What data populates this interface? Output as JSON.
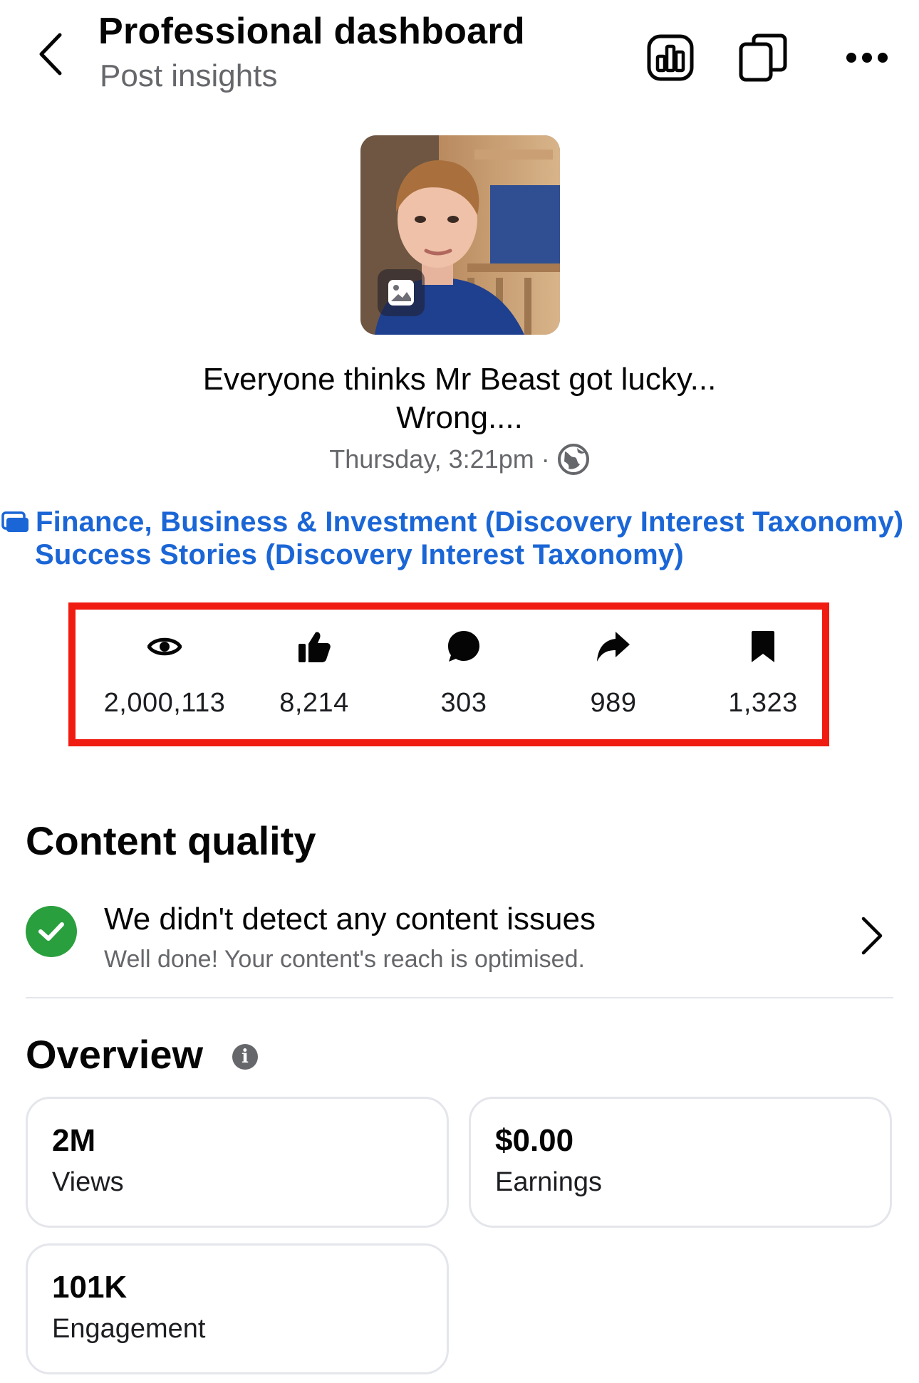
{
  "header": {
    "title": "Professional dashboard",
    "subtitle": "Post insights"
  },
  "post": {
    "caption_line1": "Everyone thinks Mr Beast got lucky...",
    "caption_line2": "Wrong....",
    "timestamp": "Thursday, 3:21pm ·",
    "topics_line1": "Finance, Business & Investment (Discovery Interest Taxonomy)",
    "topics_separator": "•",
    "topics_line2": "Success Stories (Discovery Interest Taxonomy)"
  },
  "stats": [
    {
      "icon": "eye-icon",
      "value": "2,000,113"
    },
    {
      "icon": "like-icon",
      "value": "8,214"
    },
    {
      "icon": "comment-icon",
      "value": "303"
    },
    {
      "icon": "share-icon",
      "value": "989"
    },
    {
      "icon": "bookmark-icon",
      "value": "1,323"
    }
  ],
  "content_quality": {
    "title": "Content quality",
    "status_title": "We didn't detect any content issues",
    "status_subtitle": "Well done! Your content's reach is optimised."
  },
  "overview": {
    "title": "Overview",
    "cards": [
      {
        "value": "2M",
        "label": "Views"
      },
      {
        "value": "$0.00",
        "label": "Earnings"
      },
      {
        "value": "101K",
        "label": "Engagement"
      }
    ]
  },
  "colors": {
    "accent_blue": "#1b66d6",
    "highlight_red": "#f01c12",
    "success_green": "#2a9f3e",
    "secondary_text": "#65676b"
  }
}
